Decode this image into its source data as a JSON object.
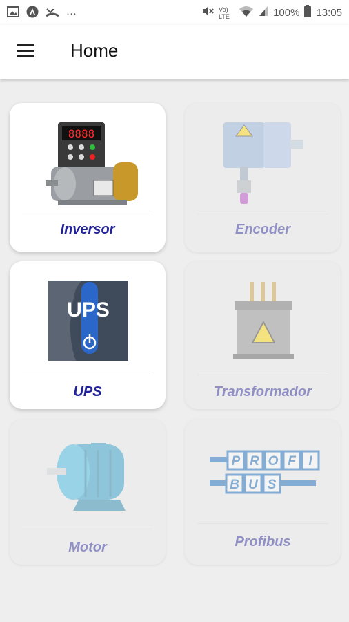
{
  "status_bar": {
    "left_icons": [
      "image-icon",
      "app-icon",
      "missed-call-icon",
      "more-icon"
    ],
    "more": "···",
    "network": "Vo) LTE",
    "battery": "100%",
    "time": "13:05"
  },
  "app_bar": {
    "title": "Home"
  },
  "cards": [
    {
      "label": "Inversor",
      "enabled": true
    },
    {
      "label": "Encoder",
      "enabled": false
    },
    {
      "label": "UPS",
      "enabled": true,
      "art_text": "UPS"
    },
    {
      "label": "Transformador",
      "enabled": false
    },
    {
      "label": "Motor",
      "enabled": false
    },
    {
      "label": "Profibus",
      "enabled": false,
      "art_text_top": [
        "P",
        "R",
        "O",
        "F",
        "I"
      ],
      "art_text_bottom": [
        "B",
        "U",
        "S"
      ]
    }
  ],
  "colors": {
    "label_enabled": "#22229a",
    "label_disabled": "#9090c6",
    "background": "#eeeeee"
  }
}
